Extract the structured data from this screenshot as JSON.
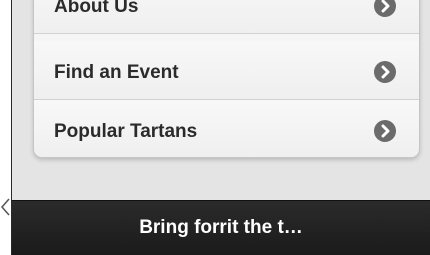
{
  "menu": {
    "items": [
      {
        "label": "About Us",
        "icon": "chevron-right-circle-icon"
      },
      {
        "label": "Find an Event",
        "icon": "chevron-right-circle-icon"
      },
      {
        "label": "Popular Tartans",
        "icon": "chevron-right-circle-icon"
      }
    ]
  },
  "footer": {
    "title": "Bring forrit the t…"
  },
  "colors": {
    "screen_bg": "#e4e4e4",
    "card_bg": "#f5f5f5",
    "label_text": "#2b2b2b",
    "chevron_bg": "#6b6b6b",
    "footer_bg": "#1f1f1f",
    "footer_text": "#ffffff"
  }
}
